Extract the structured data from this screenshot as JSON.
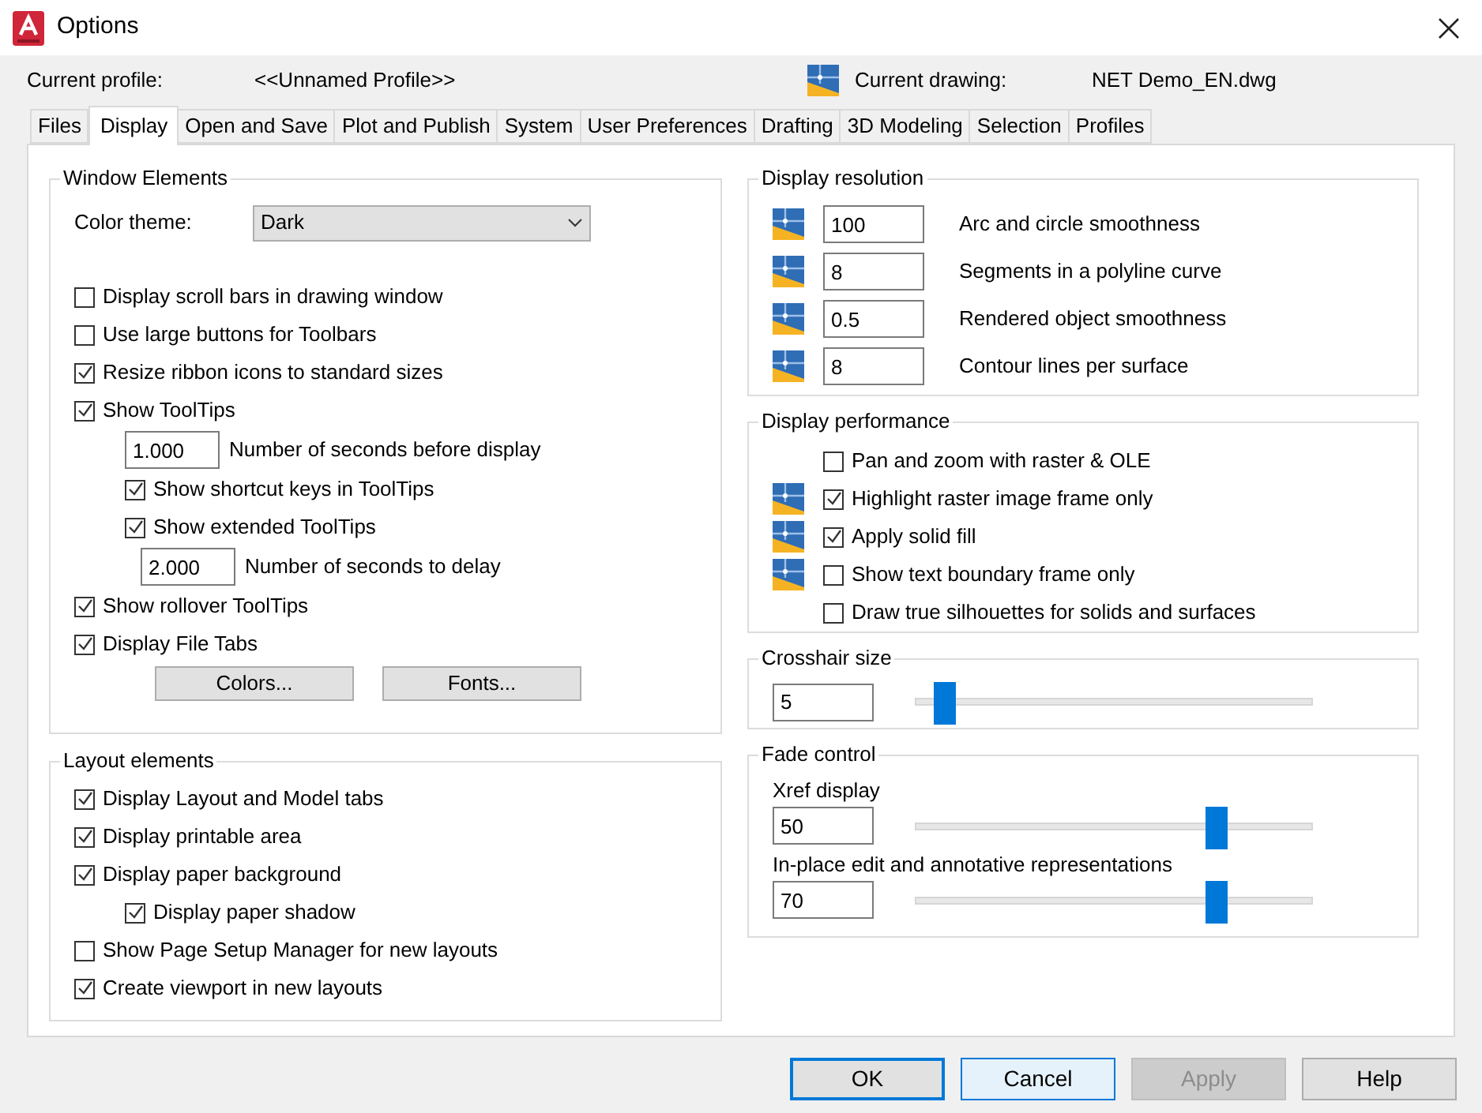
{
  "window": {
    "title": "Options"
  },
  "profile": {
    "label": "Current profile:",
    "value": "<<Unnamed Profile>>",
    "drawing_label": "Current drawing:",
    "drawing_value": "NET Demo_EN.dwg"
  },
  "tabs": [
    {
      "label": "Files",
      "selected": false
    },
    {
      "label": "Display",
      "selected": true
    },
    {
      "label": "Open and Save",
      "selected": false
    },
    {
      "label": "Plot and Publish",
      "selected": false
    },
    {
      "label": "System",
      "selected": false
    },
    {
      "label": "User Preferences",
      "selected": false
    },
    {
      "label": "Drafting",
      "selected": false
    },
    {
      "label": "3D Modeling",
      "selected": false
    },
    {
      "label": "Selection",
      "selected": false
    },
    {
      "label": "Profiles",
      "selected": false
    }
  ],
  "window_elements": {
    "title": "Window Elements",
    "color_theme": {
      "label": "Color theme:",
      "value": "Dark"
    },
    "items": [
      {
        "kind": "checkbox",
        "label": "Display scroll bars in drawing window",
        "checked": false
      },
      {
        "kind": "checkbox",
        "label": "Use large buttons for Toolbars",
        "checked": false
      },
      {
        "kind": "checkbox",
        "label": "Resize ribbon icons to standard sizes",
        "checked": true
      },
      {
        "kind": "checkbox",
        "label": "Show ToolTips",
        "checked": true,
        "children": [
          {
            "kind": "number",
            "value": "1.000",
            "label": "Number of seconds before display"
          },
          {
            "kind": "checkbox",
            "label": "Show shortcut keys in ToolTips",
            "checked": true
          },
          {
            "kind": "checkbox",
            "label": "Show extended ToolTips",
            "checked": true,
            "children": [
              {
                "kind": "number",
                "value": "2.000",
                "label": "Number of seconds to delay"
              }
            ]
          }
        ]
      },
      {
        "kind": "checkbox",
        "label": "Show rollover ToolTips",
        "checked": true
      },
      {
        "kind": "checkbox",
        "label": "Display File Tabs",
        "checked": true
      }
    ],
    "buttons": [
      "Colors...",
      "Fonts..."
    ]
  },
  "layout_elements": {
    "title": "Layout elements",
    "items": [
      {
        "kind": "checkbox",
        "label": "Display Layout and Model tabs",
        "checked": true
      },
      {
        "kind": "checkbox",
        "label": "Display printable area",
        "checked": true
      },
      {
        "kind": "checkbox",
        "label": "Display paper background",
        "checked": true,
        "children": [
          {
            "kind": "checkbox",
            "label": "Display paper shadow",
            "checked": true
          }
        ]
      },
      {
        "kind": "checkbox",
        "label": "Show Page Setup Manager for new layouts",
        "checked": false
      },
      {
        "kind": "checkbox",
        "label": "Create viewport in new layouts",
        "checked": true
      }
    ]
  },
  "display_resolution": {
    "title": "Display resolution",
    "rows": [
      {
        "value": "100",
        "label": "Arc and circle smoothness"
      },
      {
        "value": "8",
        "label": "Segments in a polyline curve"
      },
      {
        "value": "0.5",
        "label": "Rendered object smoothness"
      },
      {
        "value": "8",
        "label": "Contour lines per surface"
      }
    ]
  },
  "display_performance": {
    "title": "Display performance",
    "rows": [
      {
        "label": "Pan and zoom with raster & OLE",
        "checked": false,
        "saved_in_drawing": false
      },
      {
        "label": "Highlight raster image frame only",
        "checked": true,
        "saved_in_drawing": true
      },
      {
        "label": "Apply solid fill",
        "checked": true,
        "saved_in_drawing": true
      },
      {
        "label": "Show text boundary frame only",
        "checked": false,
        "saved_in_drawing": true
      },
      {
        "label": "Draw true silhouettes for solids and surfaces",
        "checked": false,
        "saved_in_drawing": false
      }
    ]
  },
  "crosshair": {
    "title": "Crosshair size",
    "value": "5",
    "level": 0.07
  },
  "fade_control": {
    "title": "Fade control",
    "rows": [
      {
        "label": "Xref display",
        "value": "50",
        "level": 0.76
      },
      {
        "label": "In-place edit and annotative representations",
        "value": "70",
        "level": 0.76
      }
    ]
  },
  "buttons": [
    {
      "label": "OK",
      "kind": "default"
    },
    {
      "label": "Cancel",
      "kind": "focused"
    },
    {
      "label": "Apply",
      "kind": "disabled"
    },
    {
      "label": "Help",
      "kind": "normal"
    }
  ]
}
